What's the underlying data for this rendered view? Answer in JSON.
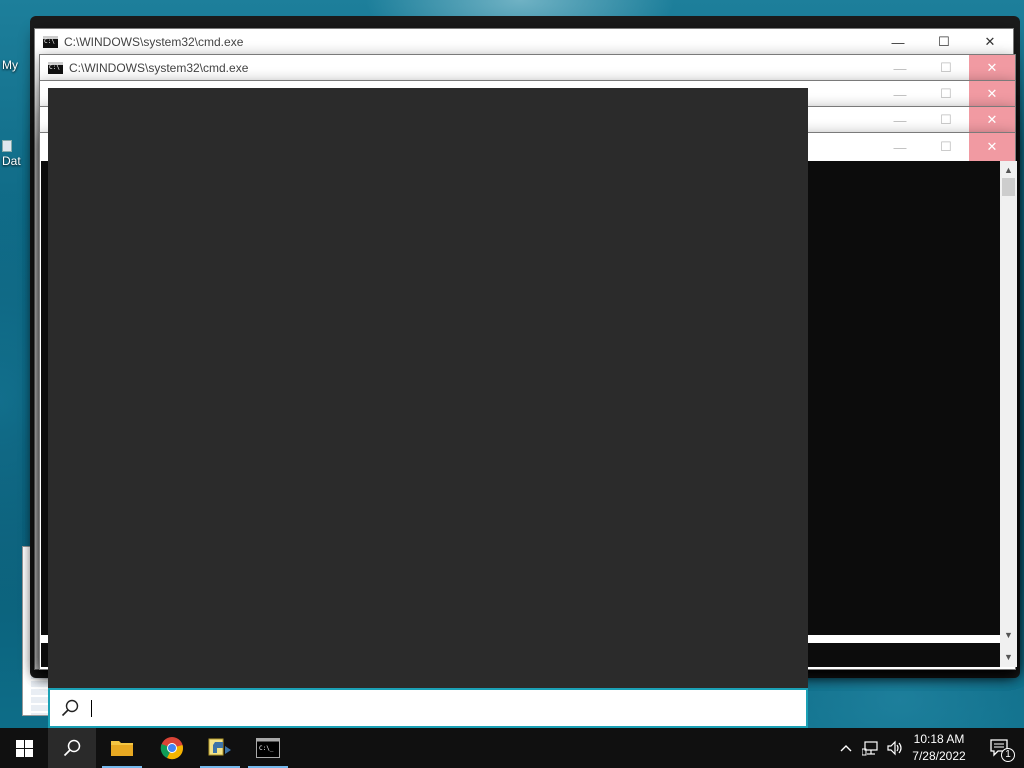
{
  "desktop": {
    "icons": [
      {
        "label": "My"
      },
      {
        "label": "Dat"
      }
    ]
  },
  "windows": [
    {
      "title": "C:\\WINDOWS\\system32\\cmd.exe",
      "state": "active"
    },
    {
      "title": "C:\\WINDOWS\\system32\\cmd.exe",
      "state": "inactive"
    },
    {
      "title": "",
      "state": "inactive"
    },
    {
      "title": "",
      "state": "inactive"
    },
    {
      "title": "",
      "state": "inactive"
    }
  ],
  "window_controls": {
    "minimize": "—",
    "maximize": "☐",
    "close": "✕"
  },
  "search": {
    "value": "",
    "placeholder": ""
  },
  "taskbar": {
    "apps": [
      {
        "icon": "windows-start-icon"
      },
      {
        "icon": "search-icon"
      },
      {
        "icon": "file-explorer-icon"
      },
      {
        "icon": "chrome-icon"
      },
      {
        "icon": "python-idle-icon"
      },
      {
        "icon": "command-prompt-icon"
      }
    ],
    "clock": {
      "time": "10:18 AM",
      "date": "7/28/2022"
    },
    "notification_count": "1"
  },
  "colors": {
    "search_border": "#1ba1b6",
    "taskbar_bg": "#101010",
    "close_inactive": "#f19aa2",
    "search_panel_bg": "#2b2b2b",
    "console_bg": "#0c0c0c"
  }
}
